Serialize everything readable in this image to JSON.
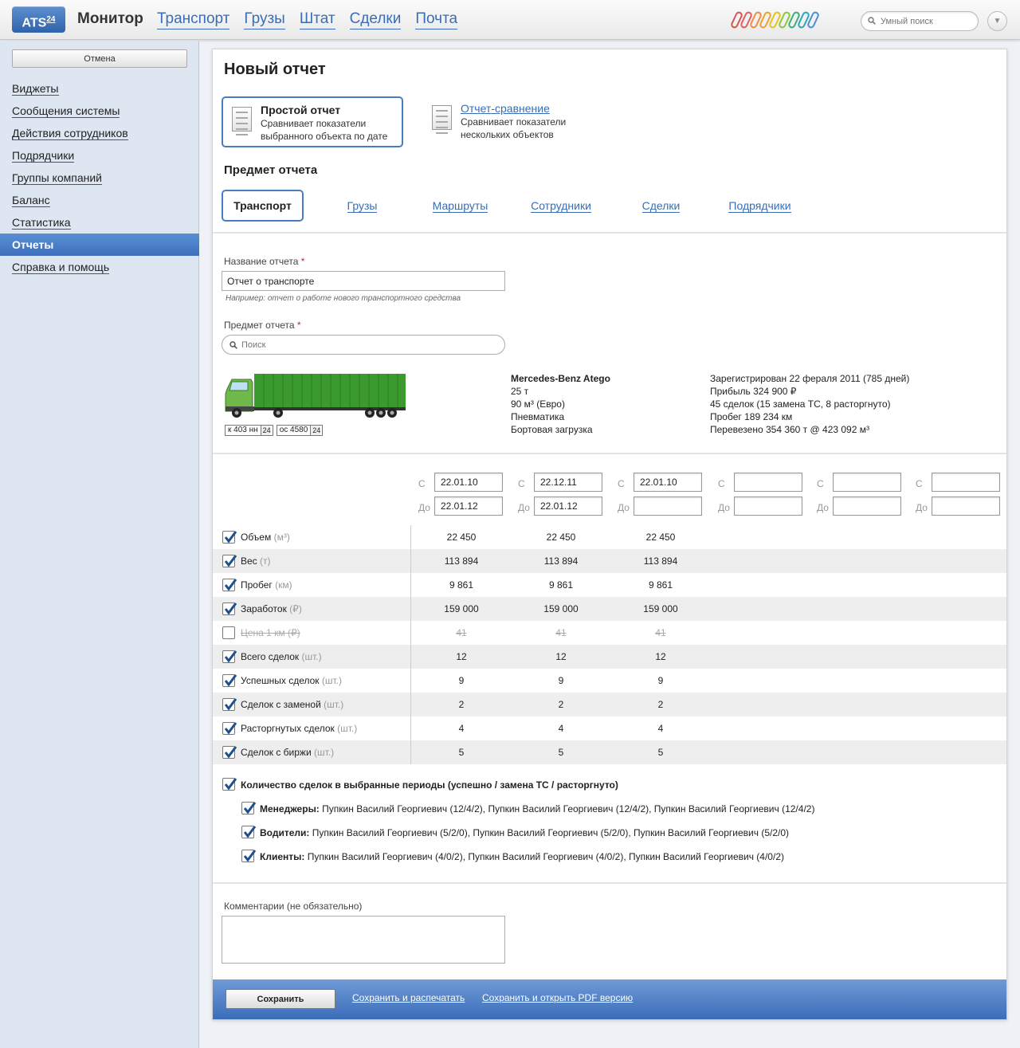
{
  "app": {
    "logo": "ATS",
    "logo_sup": "24",
    "brand": "Монитор",
    "nav": [
      "Транспорт",
      "Грузы",
      "Штат",
      "Сделки",
      "Почта"
    ],
    "search_placeholder": "Умный поиск"
  },
  "sidebar": {
    "cancel_label": "Отмена",
    "items": [
      {
        "label": "Виджеты"
      },
      {
        "label": "Сообщения системы"
      },
      {
        "label": "Действия сотрудников"
      },
      {
        "label": "Подрядчики"
      },
      {
        "label": "Группы компаний"
      },
      {
        "label": "Баланс"
      },
      {
        "label": "Статистика"
      },
      {
        "label": "Отчеты",
        "active": true
      },
      {
        "label": "Справка и помощь"
      }
    ]
  },
  "page": {
    "title": "Новый отчет",
    "report_types": [
      {
        "title": "Простой отчет",
        "description": "Сравнивает показатели выбранного объекта по дате",
        "selected": true
      },
      {
        "title": "Отчет-сравнение",
        "description": "Сравнивает показатели нескольких объектов",
        "selected": false
      }
    ],
    "subject_title": "Предмет отчета",
    "tabs": [
      "Транспорт",
      "Грузы",
      "Маршруты",
      "Сотрудники",
      "Сделки",
      "Подрядчики"
    ],
    "active_tab": "Транспорт"
  },
  "form": {
    "name_label": "Название отчета",
    "required_mark": "*",
    "name_value": "Отчет о транспорте",
    "name_hint": "Например: отчет о работе нового транспортного средства",
    "subject_label": "Предмет отчета",
    "subject_placeholder": "Поиск"
  },
  "vehicle": {
    "plates": [
      {
        "number": "к 403 нн",
        "region": "24"
      },
      {
        "number": "ос 4580",
        "region": "24"
      }
    ],
    "name": "Mercedes-Benz Atego",
    "specs": [
      "25 т",
      "90 м³ (Евро)",
      "Пневматика",
      "Бортовая загрузка"
    ],
    "stats": [
      "Зарегистрирован 22 фераля 2011 (785 дней)",
      "Прибыль 324 900 ₽",
      "45 сделок (15 замена ТС, 8 расторгнуто)",
      "Пробег 189 234 км",
      "Перевезено 354 360 т @ 423 092 м³"
    ]
  },
  "periods": {
    "from_label": "С",
    "to_label": "До",
    "items": [
      {
        "from": "22.01.10",
        "to": "22.01.12"
      },
      {
        "from": "22.12.11",
        "to": "22.01.12"
      },
      {
        "from": "22.01.10",
        "to": ""
      },
      {
        "from": "",
        "to": ""
      },
      {
        "from": "",
        "to": ""
      },
      {
        "from": "",
        "to": ""
      }
    ]
  },
  "metrics": [
    {
      "label": "Объем",
      "unit": "(м³)",
      "checked": true,
      "values": [
        "22 450",
        "22 450",
        "22 450"
      ]
    },
    {
      "label": "Вес",
      "unit": "(т)",
      "checked": true,
      "values": [
        "113 894",
        "113 894",
        "113 894"
      ]
    },
    {
      "label": "Пробег",
      "unit": "(км)",
      "checked": true,
      "values": [
        "9 861",
        "9 861",
        "9 861"
      ]
    },
    {
      "label": "Заработок",
      "unit": "(₽)",
      "checked": true,
      "values": [
        "159 000",
        "159 000",
        "159 000"
      ]
    },
    {
      "label": "Цена 1 км",
      "unit": "(₽)",
      "checked": false,
      "values": [
        "41",
        "41",
        "41"
      ]
    },
    {
      "label": "Всего сделок",
      "unit": "(шт.)",
      "checked": true,
      "values": [
        "12",
        "12",
        "12"
      ]
    },
    {
      "label": "Успешных сделок",
      "unit": "(шт.)",
      "checked": true,
      "values": [
        "9",
        "9",
        "9"
      ]
    },
    {
      "label": "Сделок с заменой",
      "unit": "(шт.)",
      "checked": true,
      "values": [
        "2",
        "2",
        "2"
      ]
    },
    {
      "label": "Расторгнутых сделок",
      "unit": "(шт.)",
      "checked": true,
      "values": [
        "4",
        "4",
        "4"
      ]
    },
    {
      "label": "Сделок с биржи",
      "unit": "(шт.)",
      "checked": true,
      "values": [
        "5",
        "5",
        "5"
      ]
    }
  ],
  "deals": {
    "title": "Количество сделок в выбранные периоды (успешно / замена ТС / расторгнуто)",
    "rows": [
      {
        "label": "Менеджеры:",
        "text": "Пупкин Василий Георгиевич (12/4/2), Пупкин Василий Георгиевич (12/4/2), Пупкин Василий Георгиевич (12/4/2)"
      },
      {
        "label": "Водители:",
        "text": "Пупкин Василий Георгиевич (5/2/0), Пупкин Василий Георгиевич (5/2/0), Пупкин Василий Георгиевич (5/2/0)"
      },
      {
        "label": "Клиенты:",
        "text": "Пупкин Василий Георгиевич (4/0/2), Пупкин Василий Георгиевич (4/0/2), Пупкин Василий Георгиевич (4/0/2)"
      }
    ]
  },
  "comment": {
    "label": "Комментарии (не обязательно)",
    "value": ""
  },
  "footer": {
    "save_label": "Сохранить",
    "print_link": "Сохранить и распечатать",
    "pdf_link": "Сохранить и открыть PDF версию"
  },
  "colors": {
    "accent": "#3a6db5",
    "active_item": "#4a7cc0",
    "sidebar_bg": "#dde6f1",
    "footer": "#4f80c6",
    "required": "#cc2222",
    "clips": [
      "#d9534f",
      "#e25d5d",
      "#f08c3c",
      "#f0a030",
      "#e6c21e",
      "#8cc63e",
      "#3ab07a",
      "#2aa8b8",
      "#4e8ed8"
    ]
  }
}
